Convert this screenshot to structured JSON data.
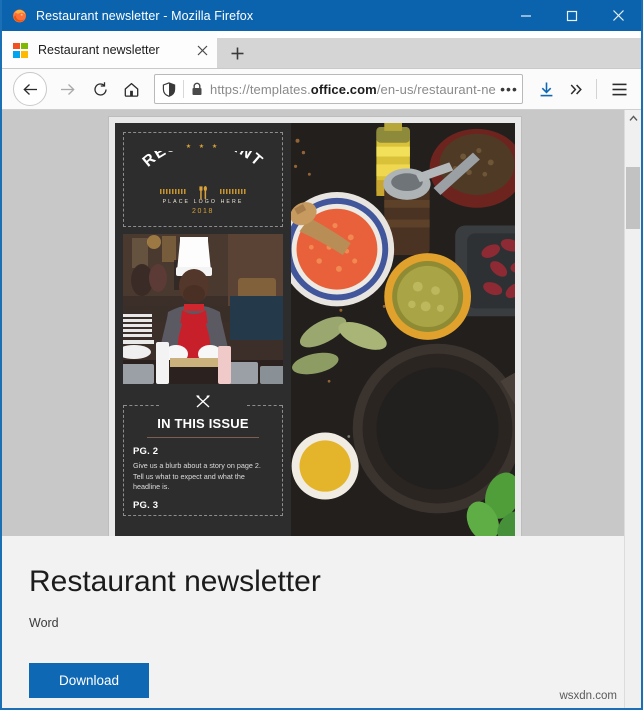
{
  "window": {
    "title": "Restaurant newsletter - Mozilla Firefox",
    "app_icon": "firefox-logo",
    "controls": {
      "minimize": "minimize-icon",
      "maximize": "maximize-icon",
      "close": "close-icon"
    },
    "titlebar_color": "#0b63ad"
  },
  "tabs": [
    {
      "title": "Restaurant newsletter",
      "favicon": "microsoft-office-icon",
      "active": true
    }
  ],
  "newtab_label": "+",
  "toolbar": {
    "back": "back-arrow-icon",
    "forward": "forward-arrow-icon",
    "reload": "reload-icon",
    "home": "home-icon",
    "shield": "shield-icon",
    "lock": "padlock-icon",
    "url_scheme": "https://templates.",
    "url_domain": "office.com",
    "url_path": "/en-us/restaurant-ne",
    "url_full": "https://templates.office.com/en-us/restaurant-ne",
    "page_actions": "•••",
    "downloads": "download-arrow-icon",
    "overflow": "double-chevron-icon",
    "menu": "hamburger-menu-icon",
    "accent_color": "#0f68b4"
  },
  "template_preview": {
    "logo": {
      "stars": "★ ★ ★",
      "brand": "RESTAURANT",
      "subtitle": "PLACE LOGO HERE",
      "year": "2018",
      "utensils": "🍴",
      "accent_color": "#d9a23a"
    },
    "issue": {
      "icon": "crossed-utensils-icon",
      "heading": "IN THIS ISSUE",
      "entries": [
        {
          "page": "PG. 2",
          "blurb": "Give us a blurb about a story on page 2.  Tell us what to expect and what the headline is."
        },
        {
          "page": "PG. 3",
          "blurb": ""
        }
      ]
    },
    "photos": [
      {
        "name": "chef-preparing-food-photo"
      },
      {
        "name": "ingredients-flatlay-photo"
      }
    ],
    "background_color": "#2d2d2d"
  },
  "details": {
    "title": "Restaurant newsletter",
    "product": "Word",
    "download_label": "Download",
    "button_color": "#0f68b4"
  },
  "watermark": "wsxdn.com",
  "scrollbar": {
    "up_arrow": "chevron-up-icon"
  }
}
